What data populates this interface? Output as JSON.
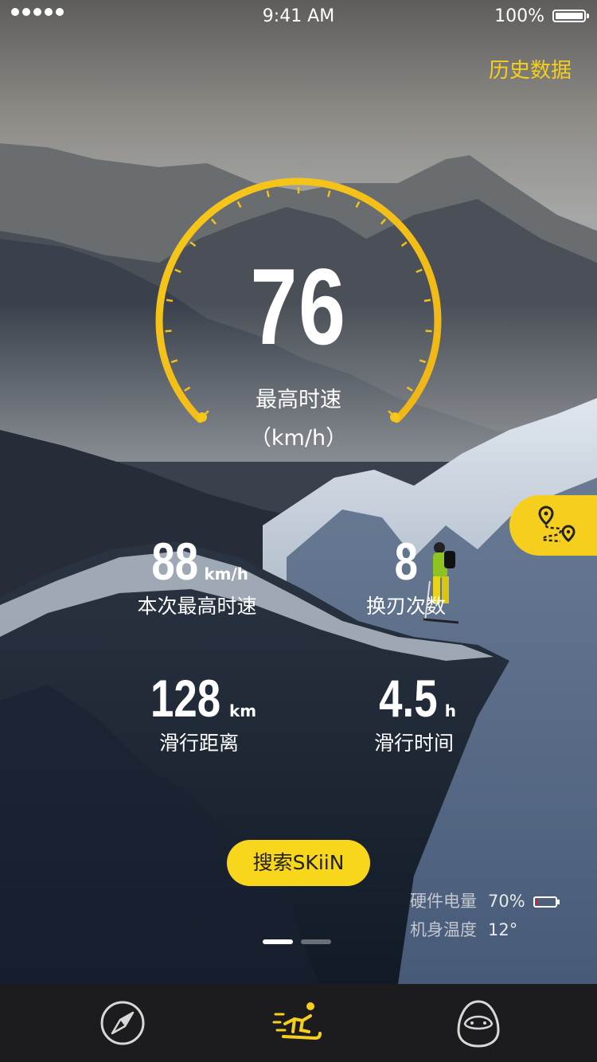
{
  "status_bar": {
    "time": "9:41 AM",
    "battery": "100%"
  },
  "header": {
    "history_link": "历史数据"
  },
  "gauge": {
    "value": "76",
    "label": "最高时速",
    "unit": "（km/h）"
  },
  "stats": [
    {
      "value": "88",
      "unit": "km/h",
      "label": "本次最高时速"
    },
    {
      "value": "8",
      "unit": "",
      "label": "换刃次数"
    },
    {
      "value": "128",
      "unit": "km",
      "label": "滑行距离"
    },
    {
      "value": "4.5",
      "unit": "h",
      "label": "滑行时间"
    }
  ],
  "search_button": "搜索SKiiN",
  "hardware": {
    "battery_label": "硬件电量",
    "battery_value": "70%",
    "temp_label": "机身温度",
    "temp_value": "12°"
  },
  "pager": {
    "pages": 2,
    "active": 1
  },
  "colors": {
    "accent": "#f6cf1e",
    "tabbar": "#1c1c1e"
  },
  "icons": {
    "route": "route-map-icon",
    "tab_left": "compass-icon",
    "tab_center": "skiing-icon",
    "tab_right": "egg-face-icon"
  }
}
